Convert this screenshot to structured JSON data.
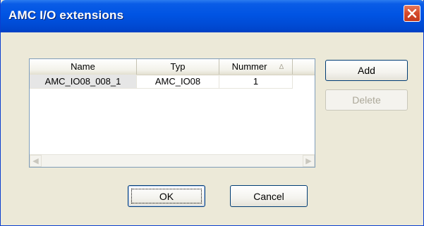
{
  "window": {
    "title": "AMC I/O extensions"
  },
  "icons": {
    "close": "close-x-icon",
    "scroll_left": "arrow-left-icon",
    "scroll_right": "arrow-right-icon",
    "sort": "sort-ascending-icon"
  },
  "list": {
    "columns": [
      "Name",
      "Typ",
      "Nummer"
    ],
    "sort_indicator": "∆",
    "rows": [
      [
        "AMC_IO08_008_1",
        "AMC_IO08",
        "1"
      ]
    ]
  },
  "buttons": {
    "add": "Add",
    "delete": "Delete",
    "ok": "OK",
    "cancel": "Cancel"
  },
  "colors": {
    "title_bar": "#0054e3",
    "close_button": "#d4492b",
    "dialog_bg": "#ece9d8"
  }
}
